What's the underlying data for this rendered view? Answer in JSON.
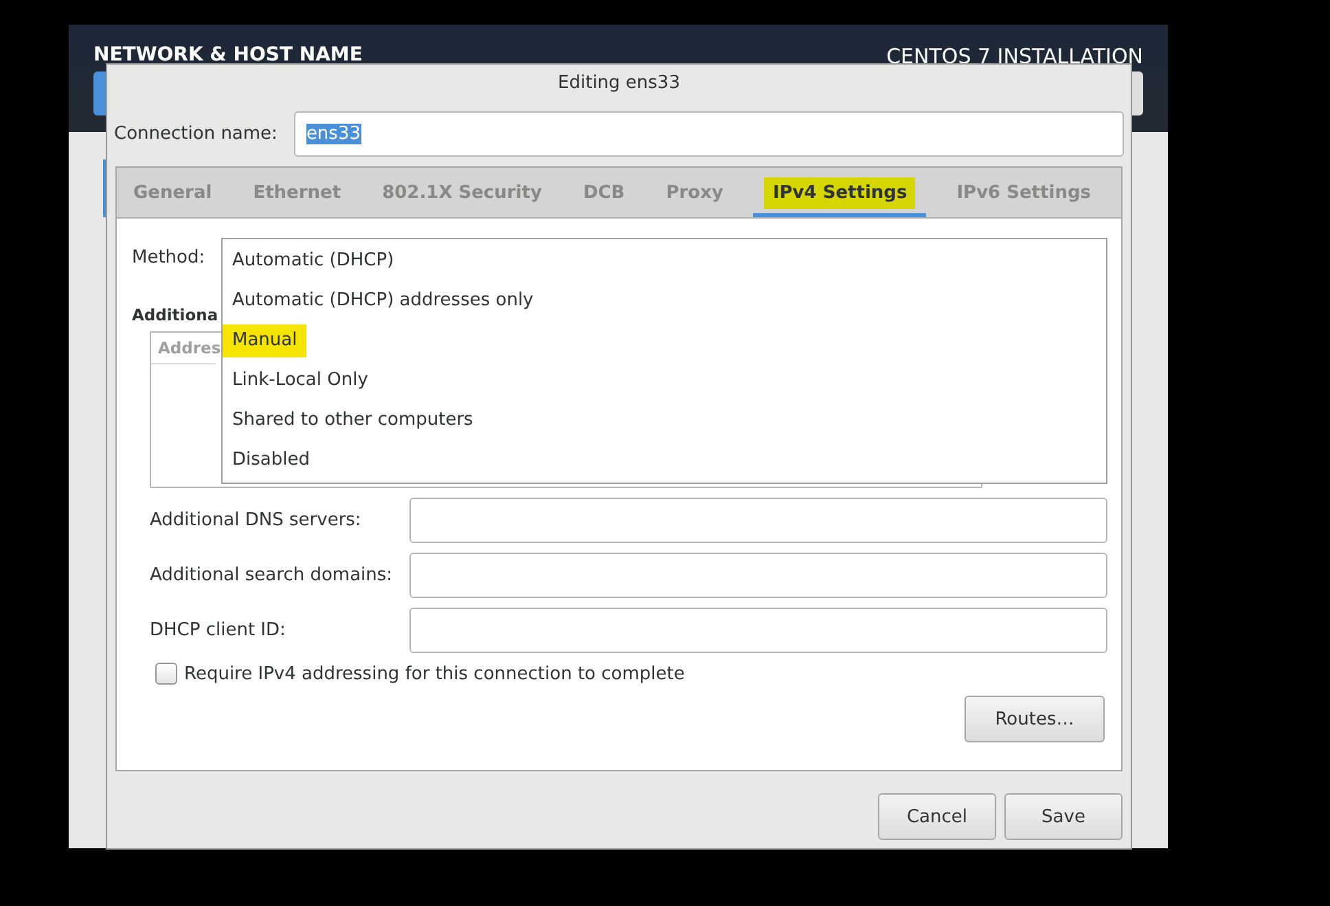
{
  "installer": {
    "title": "NETWORK & HOST NAME",
    "product": "CENTOS 7 INSTALLATION"
  },
  "dialog": {
    "title": "Editing ens33",
    "connection_name": {
      "label": "Connection name:",
      "value": "ens33",
      "value_selected": true
    },
    "tabs": [
      {
        "label": "General",
        "selected": false
      },
      {
        "label": "Ethernet",
        "selected": false
      },
      {
        "label": "802.1X Security",
        "selected": false
      },
      {
        "label": "DCB",
        "selected": false
      },
      {
        "label": "Proxy",
        "selected": false
      },
      {
        "label": "IPv4 Settings",
        "selected": true
      },
      {
        "label": "IPv6 Settings",
        "selected": false
      }
    ],
    "method": {
      "label": "Method:",
      "options": [
        {
          "label": "Automatic (DHCP)",
          "selected": false
        },
        {
          "label": "Automatic (DHCP) addresses only",
          "selected": false
        },
        {
          "label": "Manual",
          "selected": true
        },
        {
          "label": "Link-Local Only",
          "selected": false
        },
        {
          "label": "Shared to other computers",
          "selected": false
        },
        {
          "label": "Disabled",
          "selected": false
        }
      ]
    },
    "addresses": {
      "heading": "Additiona",
      "column_1": "Addres"
    },
    "fields": [
      {
        "label": "Additional DNS servers:"
      },
      {
        "label": "Additional search domains:"
      },
      {
        "label": "DHCP client ID:"
      }
    ],
    "require_checkbox": {
      "label": "Require IPv4 addressing for this connection to complete",
      "checked": false
    },
    "routes_button": "Routes…",
    "buttons": [
      "Cancel",
      "Save"
    ]
  }
}
